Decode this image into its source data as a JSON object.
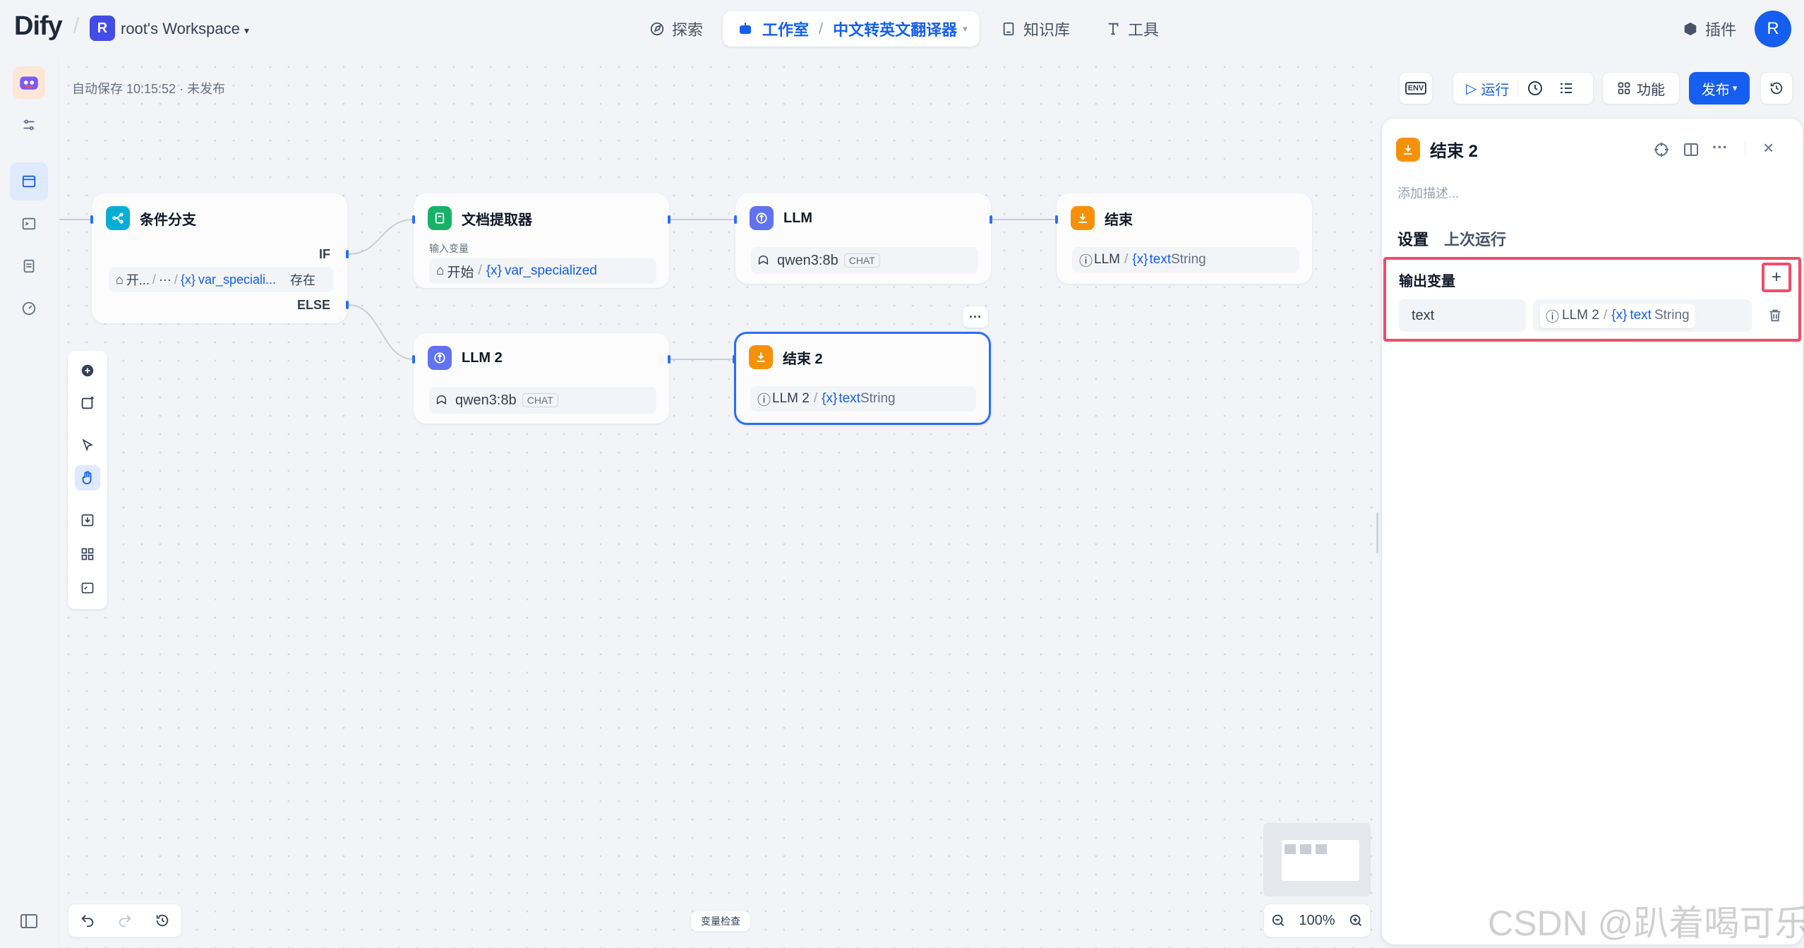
{
  "app": {
    "logo": "Dify",
    "workspace_badge": "R",
    "workspace_name": "root's Workspace"
  },
  "nav": {
    "explore": "探索",
    "studio": "工作室",
    "app_name": "中文转英文翻译器",
    "knowledge": "知识库",
    "tools": "工具",
    "plugins": "插件",
    "avatar": "R"
  },
  "status": {
    "autosave": "自动保存 10:15:52 · 未发布"
  },
  "toolbar": {
    "env": "ENV",
    "run": "运行",
    "features": "功能",
    "publish": "发布"
  },
  "nodes": {
    "ifelse": {
      "title": "条件分支",
      "if_label": "IF",
      "else_label": "ELSE",
      "cond_src": "开...",
      "cond_dots": "···",
      "cond_var": "var_speciali...",
      "cond_op": "存在"
    },
    "docext": {
      "title": "文档提取器",
      "sub": "输入变量",
      "src": "开始",
      "var": "var_specialized"
    },
    "llm": {
      "title": "LLM",
      "model": "qwen3:8b",
      "tag": "CHAT"
    },
    "end": {
      "title": "结束",
      "src": "LLM",
      "var": "text",
      "type": "String"
    },
    "llm2": {
      "title": "LLM 2",
      "model": "qwen3:8b",
      "tag": "CHAT"
    },
    "end2": {
      "title": "结束 2",
      "src": "LLM 2",
      "var": "text",
      "type": "String",
      "more": "···"
    }
  },
  "bottom": {
    "var_inspect": "变量检查",
    "zoom": "100%"
  },
  "panel": {
    "title": "结束 2",
    "desc_placeholder": "添加描述...",
    "tabs": [
      "设置",
      "上次运行"
    ],
    "output_title": "输出变量",
    "output_rows": [
      {
        "name": "text",
        "src": "LLM 2",
        "var": "text",
        "type": "String"
      }
    ]
  },
  "watermark": "CSDN @趴着喝可乐",
  "colors": {
    "accent": "#155eef",
    "highlight": "#f04d6a"
  }
}
